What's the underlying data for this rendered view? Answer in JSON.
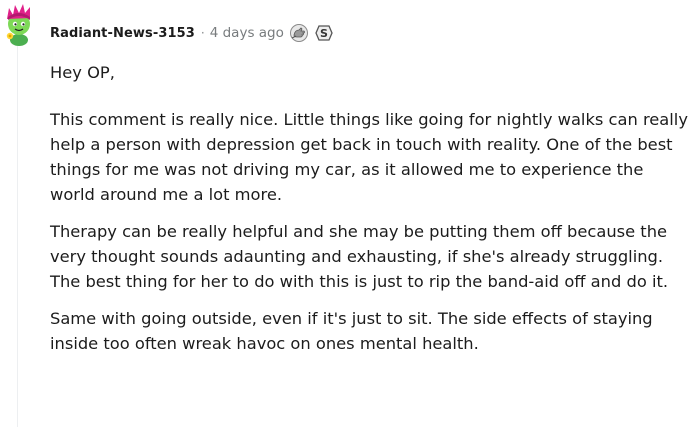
{
  "comment": {
    "username": "Radiant-News-3153",
    "separator": "·",
    "timestamp": "4 days ago",
    "awards": [
      {
        "icon": "award-hand-icon"
      },
      {
        "icon": "award-silver-icon",
        "label": "S"
      }
    ],
    "paragraphs": [
      "Hey OP,",
      "This comment is really nice. Little things like going for nightly walks can really help a person with depression get back in touch with reality. One of the best things for me was not driving my car, as it allowed me to experience the world around me a lot more.",
      "Therapy can be really helpful and she may be putting them off because the very thought sounds adaunting and exhausting, if she's already struggling. The best thing for her to do with this is just to rip the band-aid off and do it.",
      "Same with going outside, even if it's just to sit. The side effects of staying inside too often wreak havoc on ones mental health."
    ]
  },
  "colors": {
    "text": "#1c1c1c",
    "meta": "#787c7e",
    "avatar_hair": "#e0218a",
    "avatar_skin": "#7ed957"
  }
}
